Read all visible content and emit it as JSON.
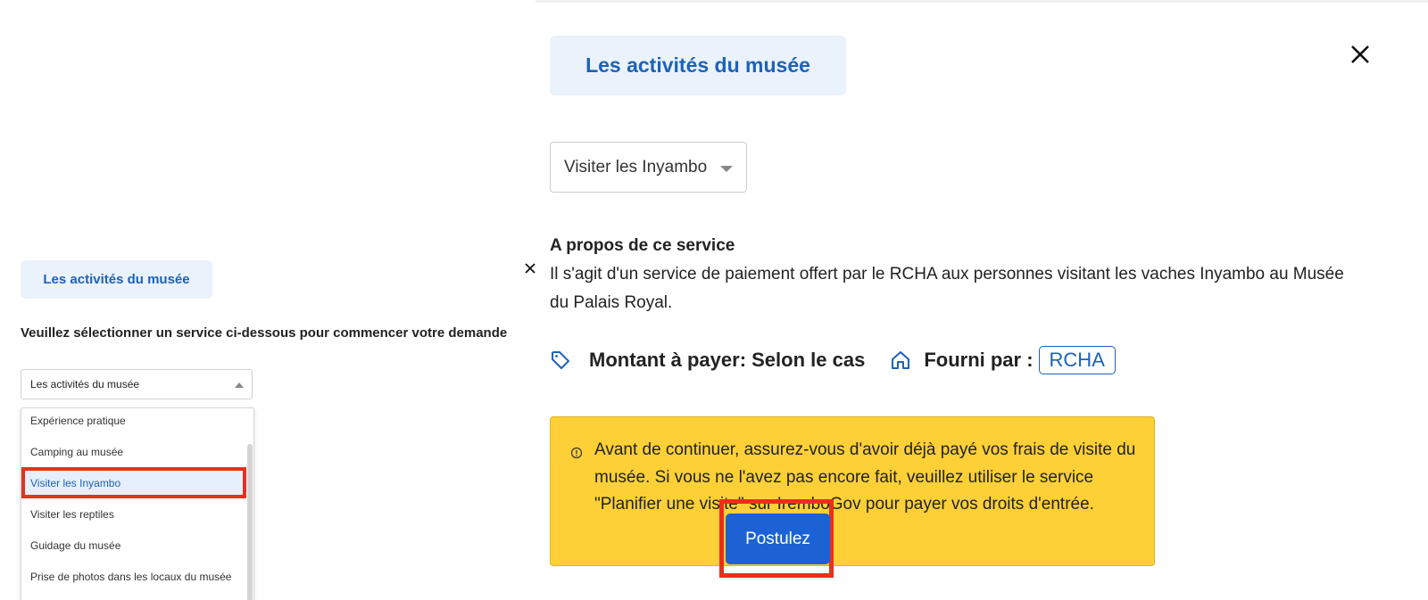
{
  "small_panel": {
    "title": "Les activités du musée",
    "instruction": "Veuillez sélectionner un service ci-dessous pour commencer votre demande",
    "select_value": "Les activités du musée",
    "options": [
      "Expérience pratique",
      "Camping au musée",
      "Visiter les Inyambo",
      "Visiter les reptiles",
      "Guidage du musée",
      "Prise de photos dans les locaux du musée"
    ],
    "selected_option": "Visiter les Inyambo"
  },
  "main_panel": {
    "title": "Les activités du musée",
    "service_select_value": "Visiter les Inyambo",
    "about_title": "A propos de ce service",
    "about_description": "Il s'agit d'un service de paiement offert par le RCHA aux personnes visitant les vaches Inyambo au Musée du Palais Royal.",
    "amount_label": "Montant à payer: Selon le cas",
    "provider_label": "Fourni par :",
    "provider": "RCHA",
    "notice": "Avant de continuer, assurez-vous d'avoir déjà payé vos frais de visite du musée. Si vous ne l'avez pas encore fait, veuillez utiliser le service \"Planifier une visite\" sur IremboGov pour payer vos droits d'entrée.",
    "apply_button": "Postulez"
  },
  "colors": {
    "accent_blue": "#1d62b8",
    "button_blue": "#1d62d4",
    "title_bg": "#eaf2fc",
    "notice_bg": "#fcd036",
    "highlight_red": "#e8301c"
  },
  "icons": [
    "close-icon",
    "chevron-up-icon",
    "chevron-down-icon",
    "tag-icon",
    "home-icon",
    "info-icon"
  ]
}
